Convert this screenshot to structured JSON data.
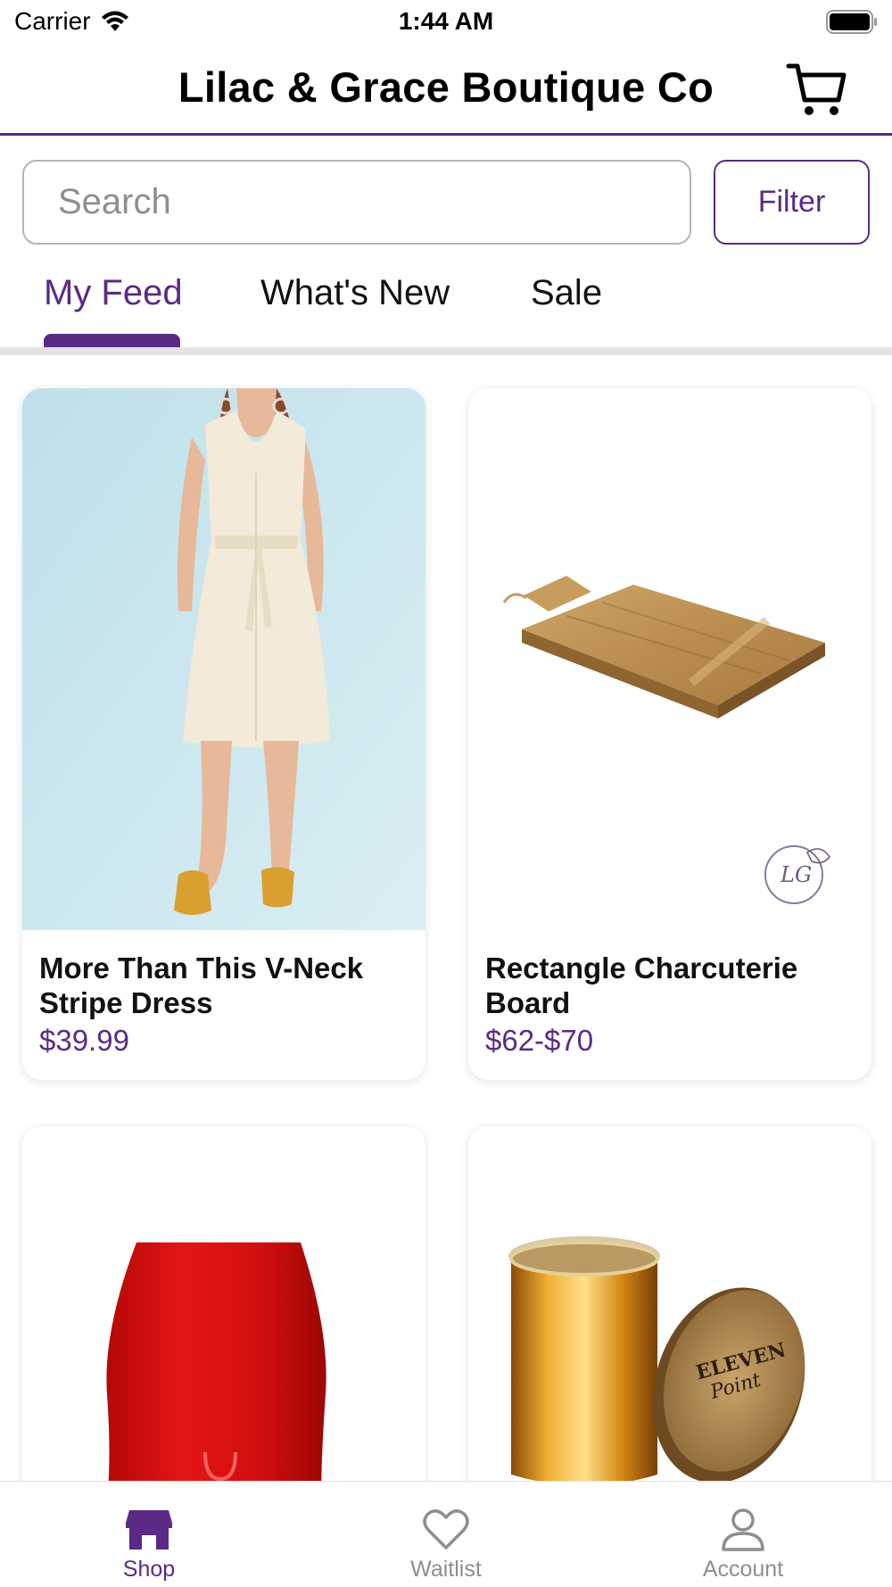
{
  "status_bar": {
    "carrier": "Carrier",
    "time": "1:44 AM"
  },
  "header": {
    "title": "Lilac & Grace Boutique Co",
    "cart_icon": "cart-icon"
  },
  "search": {
    "placeholder": "Search",
    "value": ""
  },
  "filter": {
    "label": "Filter"
  },
  "tabs": [
    {
      "label": "My Feed",
      "active": true
    },
    {
      "label": "What's New",
      "active": false
    },
    {
      "label": "Sale",
      "active": false
    }
  ],
  "products": [
    {
      "name": "More Than This V-Neck Stripe Dress",
      "price": "$39.99"
    },
    {
      "name": "Rectangle Charcuterie Board",
      "price": "$62-$70"
    },
    {
      "name": "",
      "price": ""
    },
    {
      "name": "",
      "price": ""
    }
  ],
  "candle_lid_text": {
    "line1": "ELEVEN",
    "line2": "Point"
  },
  "bottom_nav": [
    {
      "label": "Shop",
      "icon": "shop-icon",
      "active": true
    },
    {
      "label": "Waitlist",
      "icon": "heart-icon",
      "active": false
    },
    {
      "label": "Account",
      "icon": "person-icon",
      "active": false
    }
  ],
  "colors": {
    "accent": "#5b2a86",
    "price": "#5b2a86",
    "inactive_nav": "#8e8e8e"
  }
}
